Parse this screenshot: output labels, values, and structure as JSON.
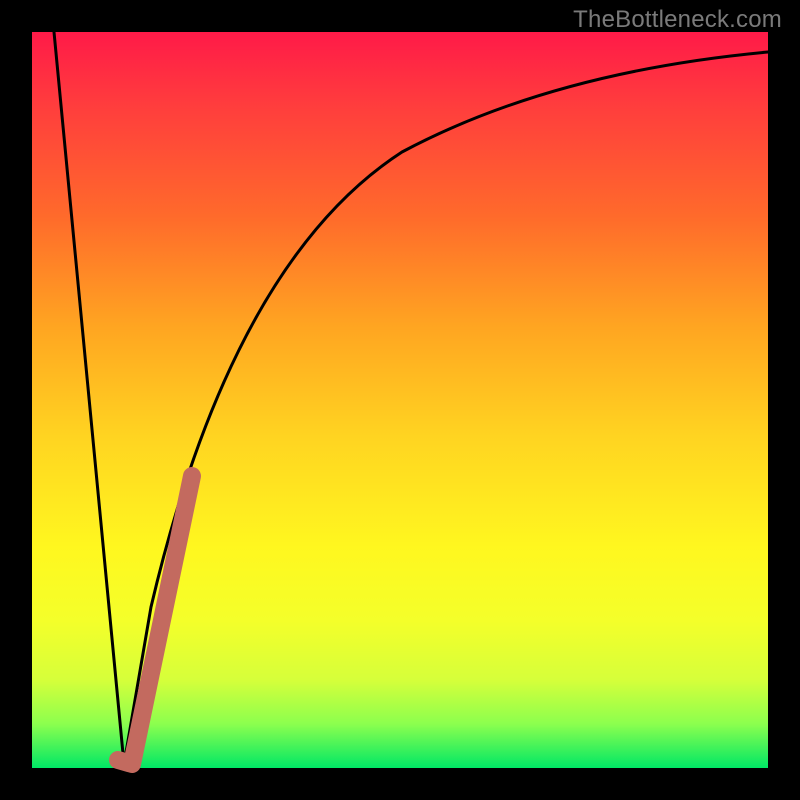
{
  "watermark": "TheBottleneck.com",
  "colors": {
    "frame": "#000000",
    "curve": "#000000",
    "highlight": "#c36a5f"
  },
  "chart_data": {
    "type": "line",
    "title": "",
    "xlabel": "",
    "ylabel": "",
    "xlim": [
      0,
      100
    ],
    "ylim": [
      0,
      100
    ],
    "grid": false,
    "series": [
      {
        "name": "bottleneck-curve",
        "x": [
          3,
          12,
          16,
          20,
          25,
          30,
          35,
          40,
          50,
          60,
          70,
          80,
          90,
          100
        ],
        "y": [
          100,
          0,
          22,
          40,
          55,
          67,
          76,
          82,
          89,
          93,
          95,
          96,
          97,
          97.5
        ]
      }
    ],
    "annotations": [
      {
        "name": "highlight-segment",
        "x": [
          12,
          20
        ],
        "y": [
          0,
          40
        ]
      }
    ]
  }
}
